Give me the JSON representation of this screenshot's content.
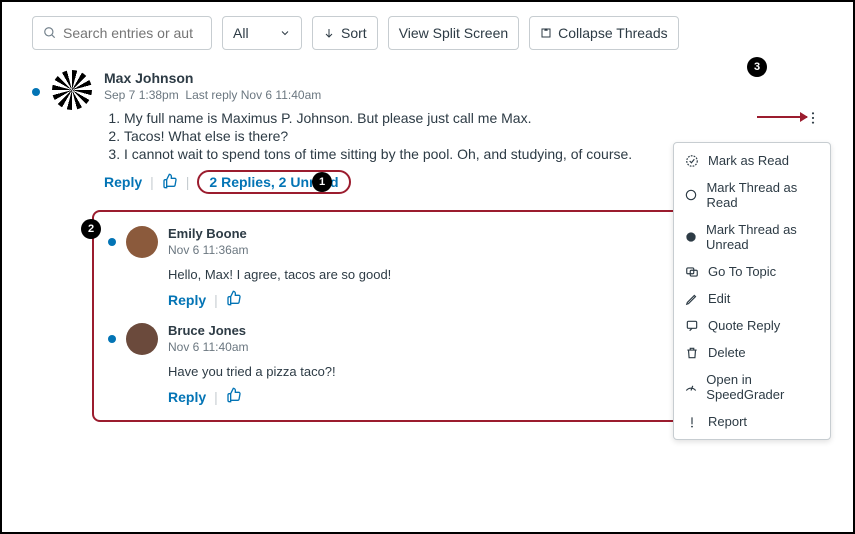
{
  "toolbar": {
    "search_placeholder": "Search entries or author",
    "filter_label": "All",
    "sort_label": "Sort",
    "split_label": "View Split Screen",
    "collapse_label": "Collapse Threads"
  },
  "post": {
    "author": "Max Johnson",
    "timestamp": "Sep 7 1:38pm",
    "last_reply": "Last reply Nov 6 11:40am",
    "items": [
      "My full name is Maximus P. Johnson. But please just call me Max.",
      "Tacos! What else is there?",
      "I cannot wait to spend tons of time sitting by the pool. Oh, and studying, of course."
    ],
    "reply_label": "Reply",
    "replies_summary": "2 Replies, 2 Unread"
  },
  "replies": [
    {
      "author": "Emily Boone",
      "timestamp": "Nov 6 11:36am",
      "text": "Hello, Max! I agree, tacos are so good!",
      "reply_label": "Reply"
    },
    {
      "author": "Bruce Jones",
      "timestamp": "Nov 6 11:40am",
      "text": "Have you tried a pizza taco?!",
      "reply_label": "Reply"
    }
  ],
  "menu": {
    "mark_read": "Mark as Read",
    "mark_thread_read": "Mark Thread as Read",
    "mark_thread_unread": "Mark Thread as Unread",
    "go_to_topic": "Go To Topic",
    "edit": "Edit",
    "quote_reply": "Quote Reply",
    "delete": "Delete",
    "speedgrader": "Open in SpeedGrader",
    "report": "Report"
  },
  "annotations": {
    "b1": "1",
    "b2": "2",
    "b3": "3"
  }
}
